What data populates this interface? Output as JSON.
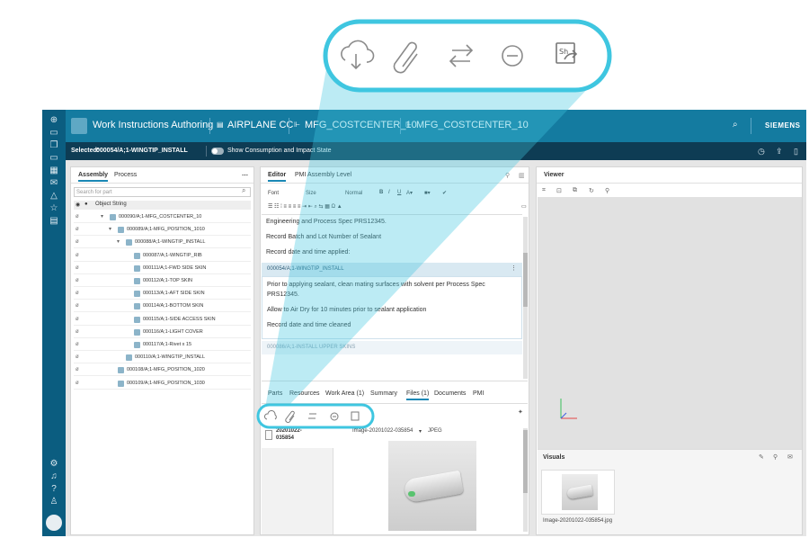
{
  "header": {
    "app_title": "Work Instructions Authoring",
    "crumbs": [
      "AIRPLANE CC",
      "MFG_COSTCENTER_10",
      "MFG_COSTCENTER_10"
    ],
    "brand": "SIEMENS"
  },
  "subheader": {
    "selected_label": "Selected:",
    "selected_value": "000054/A;1-WINGTIP_INSTALL",
    "toggle_label": "Show Consumption and Impact State"
  },
  "assembly_panel": {
    "tabs": [
      "Assembly",
      "Process"
    ],
    "search_placeholder": "Search for part",
    "column_header": "Object String",
    "rows": [
      {
        "label": "000090/A;1-MFG_COSTCENTER_10",
        "indent": 0,
        "caret": "▾"
      },
      {
        "label": "000089/A;1-MFG_POSITION_1010",
        "indent": 1,
        "caret": "▾"
      },
      {
        "label": "000088/A;1-WINGTIP_INSTALL",
        "indent": 2,
        "caret": "▾"
      },
      {
        "label": "000087/A;1-WINGTIP_RIB",
        "indent": 3,
        "caret": ""
      },
      {
        "label": "000111/A;1-FWD SIDE SKIN",
        "indent": 3,
        "caret": ""
      },
      {
        "label": "000112/A;1-TOP SKIN",
        "indent": 3,
        "caret": ""
      },
      {
        "label": "000113/A;1-AFT SIDE SKIN",
        "indent": 3,
        "caret": ""
      },
      {
        "label": "000114/A;1-BOTTOM SKIN",
        "indent": 3,
        "caret": ""
      },
      {
        "label": "000115/A;1-SIDE ACCESS SKIN",
        "indent": 3,
        "caret": ""
      },
      {
        "label": "000116/A;1-LIGHT COVER",
        "indent": 3,
        "caret": ""
      },
      {
        "label": "000117/A;1-Rivet x 15",
        "indent": 3,
        "caret": ""
      },
      {
        "label": "000110/A;1-WINGTIP_INSTALL",
        "indent": 2,
        "caret": ""
      },
      {
        "label": "000108/A;1-MFG_POSITION_1020",
        "indent": 1,
        "caret": ""
      },
      {
        "label": "000109/A;1-MFG_POSITION_1030",
        "indent": 1,
        "caret": ""
      }
    ]
  },
  "editor_panel": {
    "tabs": [
      "Editor",
      "PMI Assembly Level"
    ],
    "font_label": "Font",
    "size_label": "Size",
    "style_label": "Normal",
    "prev_lines": [
      "Engineering and Process Spec PRS12345.",
      "Record Batch and Lot Number of Sealant",
      "Record date and time applied:"
    ],
    "step_title": "000054/A;1-WINGTIP_INSTALL",
    "step_lines": [
      "Prior to applying sealant, clean mating surfaces with solvent per Process Spec",
      "PRS12345.",
      "Allow to Air Dry for 10 minutes prior to sealant application",
      "Record date and time cleaned"
    ],
    "next_step_title": "000086/A;1-INSTALL UPPER SKINS",
    "bottom_tabs": [
      "Parts",
      "Resources",
      "Work Area (1)",
      "Summary",
      "Files (1)",
      "Documents",
      "PMI"
    ],
    "file_name_line1": "20201022-",
    "file_name_line2": "035854",
    "file_title": "Image-20201022-035854",
    "file_type": "JPEG"
  },
  "viewer_panel": {
    "title": "Viewer",
    "visuals_title": "Visuals",
    "visual_caption": "Image-20201022-035854.jpg"
  },
  "file_toolbar_icons": [
    "cloud-download-icon",
    "paperclip-icon",
    "swap-arrows-icon",
    "minus-circle-icon",
    "share-snapshot-icon"
  ],
  "colors": {
    "topbar": "#147ba0",
    "subbar": "#0e3c54",
    "sidebar": "#0b5d80",
    "lens": "#3fc6e0",
    "accent": "#1a88b5"
  }
}
